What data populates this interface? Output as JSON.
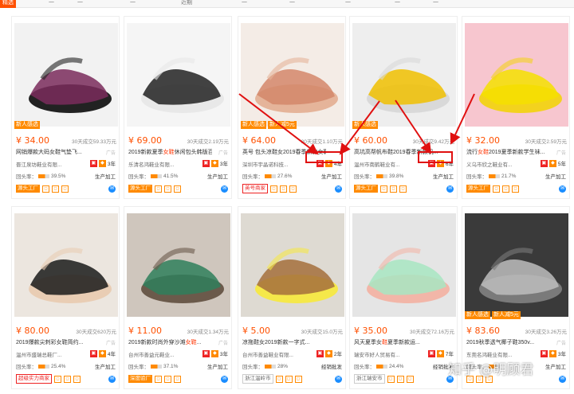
{
  "topbar": {
    "tabs": [
      "精选",
      "一",
      "一",
      "一",
      "近期",
      "一",
      "一",
      "一",
      "一",
      "一"
    ]
  },
  "products": [
    {
      "price": "¥ 34.00",
      "sold": "30天成交59.33万元",
      "title_pre": "网销爆款大码女鞋气垫飞",
      "title_hl": "",
      "title_post": "...",
      "ad": "广告",
      "shop": "晋江泉坊鞋业有限...",
      "years": "3年",
      "repeat": "回头率：",
      "repeat_pct": "39.5%",
      "mode": "生产加工",
      "badges": [
        "新人感选"
      ],
      "footer_tag": "源头工厂",
      "footer_style": "orange",
      "img_colors": [
        "#f2f2f2",
        "#222222",
        "#7a2c5c"
      ]
    },
    {
      "price": "¥ 69.00",
      "sold": "30天成交2.19万元",
      "title_pre": "2019新款夏季",
      "title_hl": "女鞋",
      "title_post": "休闲包头韩版百...",
      "ad": "广告",
      "shop": "乐清名鸿鞋业有限...",
      "years": "3年",
      "repeat": "回头率：",
      "repeat_pct": "41.5%",
      "mode": "生产加工",
      "badges": [],
      "footer_tag": "源头工厂",
      "footer_style": "orange",
      "img_colors": [
        "#f5f5f5",
        "#e8e8e8",
        "#222222"
      ]
    },
    {
      "price": "¥ 64.00",
      "sold": "30天成交1.10万元",
      "title_pre": "英号 包头凉鞋女2019春季新款女鞋",
      "title_hl": "",
      "title_post": "",
      "ad": "",
      "shop": "深圳市宇晶诺科技...",
      "years": "4年",
      "repeat": "回头率：",
      "repeat_pct": "27.6%",
      "mode": "生产加工",
      "badges": [
        "新人感选",
        "新人减5元"
      ],
      "footer_tag": "英号商家",
      "footer_style": "red",
      "img_colors": [
        "#f4ece6",
        "#e5b49a",
        "#d4876a"
      ]
    },
    {
      "price": "¥ 60.00",
      "sold": "30天成交9.42万元",
      "title_pre": "高坑高帮帆布鞋2019春季新款帆...",
      "title_hl": "",
      "title_post": "",
      "ad": "",
      "shop": "温州市南鹤鞋业有...",
      "years": "6年",
      "repeat": "回头率：",
      "repeat_pct": "39.8%",
      "mode": "生产加工",
      "badges": [
        "新人感选"
      ],
      "footer_tag": "源头工厂",
      "footer_style": "orange",
      "img_colors": [
        "#eeeeee",
        "#d9d9d9",
        "#f0c000"
      ]
    },
    {
      "price": "¥ 32.00",
      "sold": "30天成交2.59万元",
      "title_pre": "流行",
      "title_hl": "女鞋",
      "title_post": "2019夏季新款学生袜...",
      "ad": "广告",
      "shop": "义乌市欣之鞋业有...",
      "years": "5年",
      "repeat": "回头率：",
      "repeat_pct": "21.7%",
      "mode": "生产加工",
      "badges": [],
      "footer_tag": "源头工厂",
      "footer_style": "orange",
      "img_colors": [
        "#f7c6cf",
        "#f3d21e",
        "#f5e000"
      ]
    },
    {
      "price": "¥ 80.00",
      "sold": "30天成交620万元",
      "title_pre": "2019爆款尖刺彩女鞋简约...",
      "title_hl": "",
      "title_post": "",
      "ad": "广告",
      "shop": "温州市盛瑞总鞋厂...",
      "years": "4年",
      "repeat": "回头率：",
      "repeat_pct": "25.4%",
      "mode": "生产加工",
      "badges": [],
      "footer_tag": "超级实力商家",
      "footer_style": "red",
      "img_colors": [
        "#ece6df",
        "#e9cdb4",
        "#1a1a1a"
      ]
    },
    {
      "price": "¥ 11.00",
      "sold": "30天成交1.34万元",
      "title_pre": "2019新款时尚外穿沙滩",
      "title_hl": "女鞋",
      "title_post": "...",
      "ad": "广告",
      "shop": "台州市善益元鞋业...",
      "years": "3年",
      "repeat": "回头率：",
      "repeat_pct": "37.1%",
      "mode": "生产加工",
      "badges": [],
      "footer_tag": "深度验厂",
      "footer_style": "orange",
      "img_colors": [
        "#cfc6bd",
        "#6b5a4b",
        "#2f7f5c"
      ]
    },
    {
      "price": "¥ 5.00",
      "sold": "30天成交15.0万元",
      "title_pre": "凉拖鞋女2019新款一字式...",
      "title_hl": "",
      "title_post": "",
      "ad": "",
      "shop": "台州市善益鞋业有限...",
      "years": "2年",
      "repeat": "回头率：",
      "repeat_pct": "28%",
      "mode": "经销批发",
      "badges": [],
      "footer_tag": "浙江温岭市",
      "footer_style": "gray",
      "img_colors": [
        "#dedad2",
        "#f5e84a",
        "#a46f3c"
      ]
    },
    {
      "price": "¥ 35.00",
      "sold": "30天成交72.16万元",
      "title_pre": "风天夏季女",
      "title_hl": "鞋",
      "title_post": "夏季新款运...",
      "ad": "",
      "shop": "瑞安市好人贸易有...",
      "years": "7年",
      "repeat": "回头率：",
      "repeat_pct": "24.4%",
      "mode": "经销批发",
      "badges": [],
      "footer_tag": "浙江瑞安市",
      "footer_style": "gray",
      "img_colors": [
        "#e5e5e5",
        "#f2b6a8",
        "#a8e6c2"
      ]
    },
    {
      "price": "¥ 83.60",
      "sold": "30天成交3.26万元",
      "title_pre": "2019秋季透气椰子鞋350v...",
      "title_hl": "",
      "title_post": "",
      "ad": "广告",
      "shop": "东莞名鸿鞋业有限...",
      "years": "3年",
      "repeat": "回头率：",
      "repeat_pct": "",
      "mode": "生产加工",
      "badges": [
        "新人感选",
        "新人减5元"
      ],
      "footer_tag": "",
      "footer_style": "orange",
      "img_colors": [
        "#3a3a3a",
        "#7a7a7a",
        "#bdbdbd"
      ]
    }
  ],
  "watermark": "知乎 @明顾君",
  "colors": {
    "accent": "#ff5000",
    "annotation": "#e01010"
  }
}
